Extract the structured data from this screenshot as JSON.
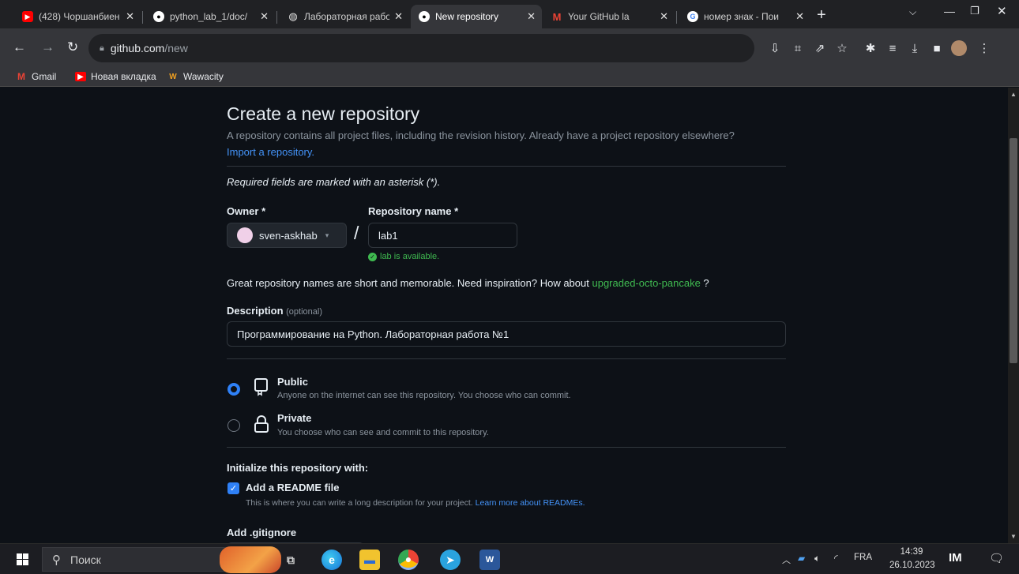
{
  "browser": {
    "tabs": [
      {
        "title": "(428) Чоршанбиен",
        "favicon": "youtube-icon",
        "active": false
      },
      {
        "title": "python_lab_1/doc/",
        "favicon": "github-icon",
        "active": false
      },
      {
        "title": "Лабораторная рабо",
        "favicon": "web-icon",
        "active": false
      },
      {
        "title": "New repository",
        "favicon": "github-icon",
        "active": true
      },
      {
        "title": "Your GitHub la",
        "favicon": "gmail-icon",
        "active": false
      },
      {
        "title": "номер знак - Пои",
        "favicon": "google-icon",
        "active": false
      }
    ],
    "new_tab": "+",
    "address": {
      "domain": "github.com",
      "path": "/new"
    },
    "bookmarks": [
      {
        "label": "Gmail",
        "icon": "gmail-icon"
      },
      {
        "label": "Новая вкладка",
        "icon": "youtube-icon"
      },
      {
        "label": "Wawacity",
        "icon": "wawacity-icon"
      }
    ]
  },
  "form": {
    "title": "Create a new repository",
    "subtitle": "A repository contains all project files, including the revision history. Already have a project repository elsewhere?",
    "import_link": "Import a repository.",
    "required_note": "Required fields are marked with an asterisk (*).",
    "owner_label": "Owner *",
    "owner_value": "sven-askhab",
    "slash": "/",
    "repo_label": "Repository name *",
    "repo_value": "lab1",
    "availability": "lab is available.",
    "inspiration_text": "Great repository names are short and memorable. Need inspiration? How about",
    "inspiration_suggestion": "upgraded-octo-pancake",
    "inspiration_end": " ?",
    "description_label": "Description",
    "description_optional": "(optional)",
    "description_value": "Программирование на Python. Лабораторная работа №1",
    "visibility": [
      {
        "label": "Public",
        "desc": "Anyone on the internet can see this repository. You choose who can commit.",
        "selected": true
      },
      {
        "label": "Private",
        "desc": "You choose who can see and commit to this repository.",
        "selected": false
      }
    ],
    "init_heading": "Initialize this repository with:",
    "readme_label": "Add a README file",
    "readme_checked": true,
    "readme_desc": "This is where you can write a long description for your project.",
    "readme_link": "Learn more about READMEs.",
    "gitignore_label": "Add .gitignore"
  },
  "taskbar": {
    "search_placeholder": "Поиск",
    "lang": "FRA",
    "time": "14:39",
    "date": "26.10.2023"
  },
  "colors": {
    "accent_blue": "#2f81f7",
    "link_blue": "#4493f8",
    "success_green": "#3fb950"
  }
}
